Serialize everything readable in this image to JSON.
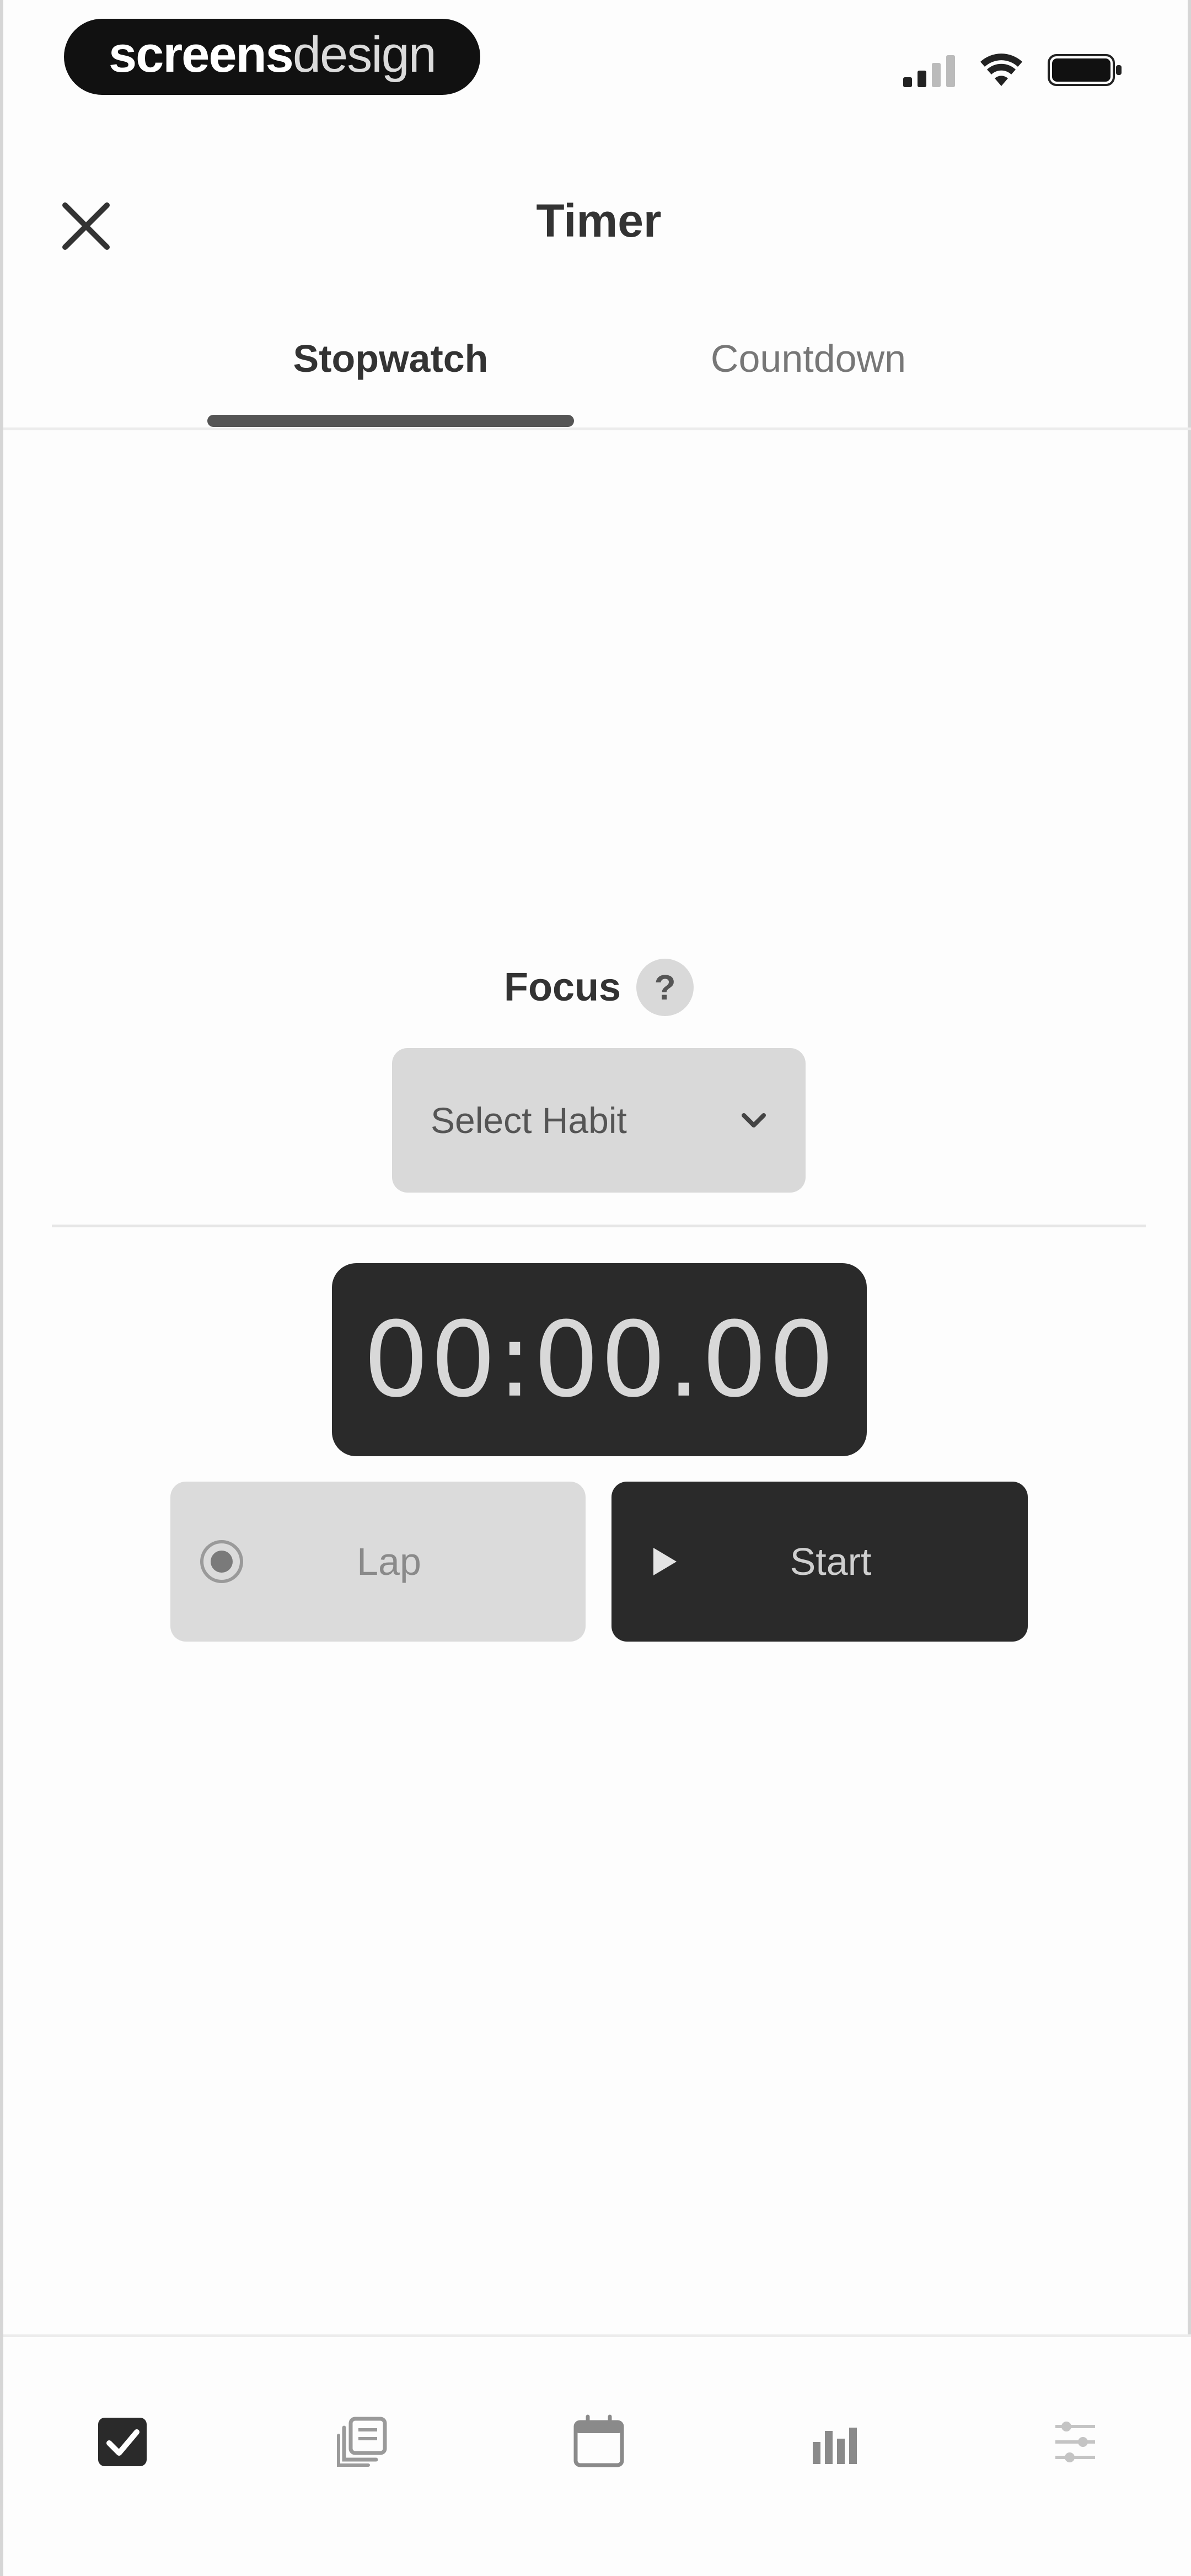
{
  "status_bar": {
    "brand": {
      "bold": "screens",
      "light": "design"
    },
    "icons": [
      "signal-icon",
      "wifi-icon",
      "battery-icon"
    ]
  },
  "header": {
    "title": "Timer",
    "close_icon": "close-icon"
  },
  "tabs": [
    {
      "label": "Stopwatch",
      "active": true
    },
    {
      "label": "Countdown",
      "active": false
    }
  ],
  "focus": {
    "label": "Focus",
    "help_symbol": "?",
    "select": {
      "selected": "Select Habit",
      "icon": "chevron-down-icon"
    }
  },
  "timer": {
    "value": "00:00.00"
  },
  "buttons": {
    "lap": {
      "label": "Lap",
      "icon": "lap-record-icon"
    },
    "start": {
      "label": "Start",
      "icon": "play-icon"
    }
  },
  "bottom_nav": {
    "items": [
      {
        "icon": "checkbox-icon",
        "active": true
      },
      {
        "icon": "stack-icon",
        "active": false
      },
      {
        "icon": "calendar-icon",
        "active": false
      },
      {
        "icon": "stats-icon",
        "active": false
      },
      {
        "icon": "settings-grid-icon",
        "active": false
      }
    ]
  },
  "colors": {
    "dark": "#2a2a2a",
    "light_fill": "#d9d9d9",
    "text": "#333333",
    "muted_text": "#777777"
  }
}
